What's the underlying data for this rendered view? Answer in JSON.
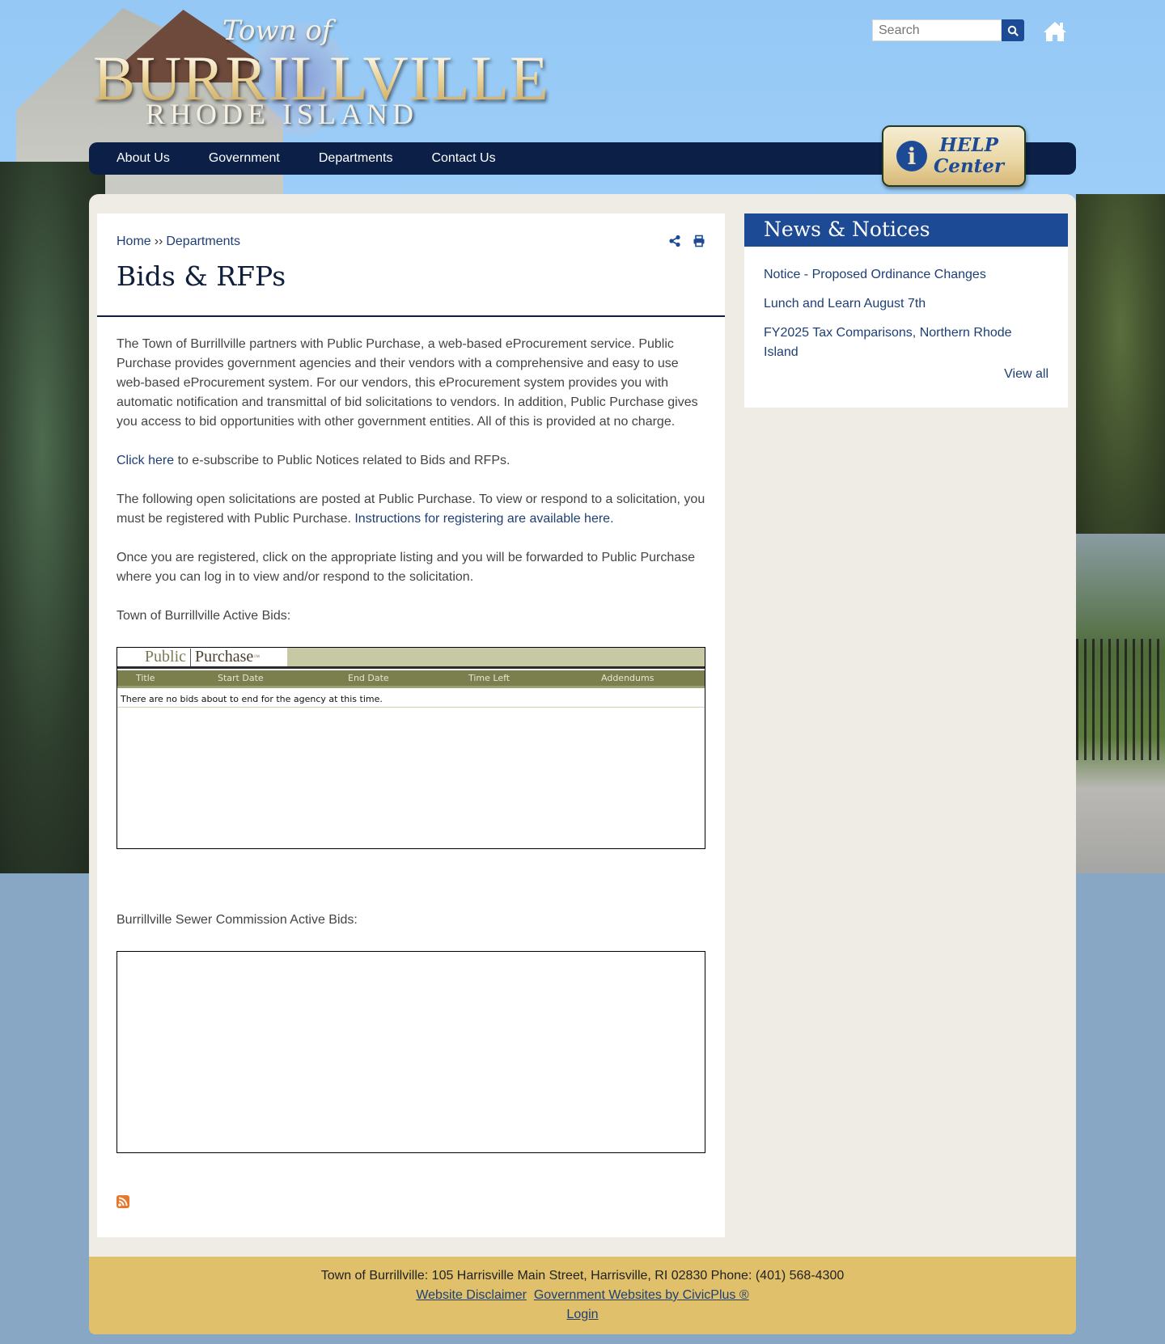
{
  "header": {
    "logo": {
      "town_of": "Town of",
      "name": "BURRILLVILLE",
      "state": "RHODE ISLAND"
    },
    "search": {
      "placeholder": "Search",
      "value": ""
    },
    "icons": {
      "search": "search-icon",
      "home": "home-icon"
    },
    "nav": [
      {
        "label": "About Us"
      },
      {
        "label": "Government"
      },
      {
        "label": "Departments"
      },
      {
        "label": "Contact Us"
      }
    ],
    "help_center": {
      "icon": "i",
      "line1": "HELP",
      "line2": "Center"
    }
  },
  "page": {
    "breadcrumb": [
      {
        "label": "Home"
      },
      {
        "label": "Departments"
      }
    ],
    "breadcrumb_separator": "››",
    "title": "Bids & RFPs",
    "tools": {
      "share": "share-icon",
      "print": "print-icon"
    },
    "paragraphs": {
      "intro": "The Town of Burrillville partners with Public Purchase, a web-based eProcurement service. Public Purchase provides government agencies and their vendors with a comprehensive and easy to use web-based eProcurement system. For our vendors, this eProcurement system provides you with automatic notification and transmittal of bid solicitations to vendors. In addition, Public Purchase gives you access to bid opportunities with other government entities. All of this is provided at no charge.",
      "subscribe_link": "Click here",
      "subscribe_rest": " to e-subscribe to Public Notices related to Bids and RFPs.",
      "following": "The following open solicitations are posted at Public Purchase. To view or respond to a solicitation, you must be registered with Public Purchase. ",
      "instructions_link": "Instructions for registering are available here.",
      "once_registered": "Once you are registered, click on the appropriate listing and you will be forwarded to Public Purchase where you can log in to view and/or respond to the solicitation.",
      "town_bids_label": "Town of Burrillville Active Bids:",
      "sewer_bids_label": "Burrillville Sewer Commission Active Bids:"
    },
    "public_purchase": {
      "logo_left": "Public",
      "logo_right": "Purchase",
      "logo_tm": "™",
      "columns": [
        "Title",
        "Start Date",
        "End Date",
        "Time Left",
        "Addendums"
      ],
      "empty_message": "There are no bids about to end for the agency at this time."
    },
    "rss": "rss-icon"
  },
  "sidebar": {
    "title": "News & Notices",
    "items": [
      {
        "label": "Notice - Proposed Ordinance Changes"
      },
      {
        "label": "Lunch and Learn August 7th"
      },
      {
        "label": "FY2025 Tax Comparisons, Northern Rhode Island"
      }
    ],
    "view_all": "View all"
  },
  "footer": {
    "address": "Town of Burrillville: 105 Harrisville Main Street, Harrisville, RI 02830  Phone: (401) 568-4300",
    "links": [
      {
        "label": "Website Disclaimer"
      },
      {
        "label": "Government Websites by CivicPlus ®"
      }
    ],
    "login": "Login"
  },
  "colors": {
    "nav_bg": "#0b1f47",
    "accent_blue": "#1d4a95",
    "link": "#1e3f75",
    "footer_bg": "#e1c06b",
    "content_bg": "#efebe5",
    "pp_header": "#7b7f4d"
  }
}
